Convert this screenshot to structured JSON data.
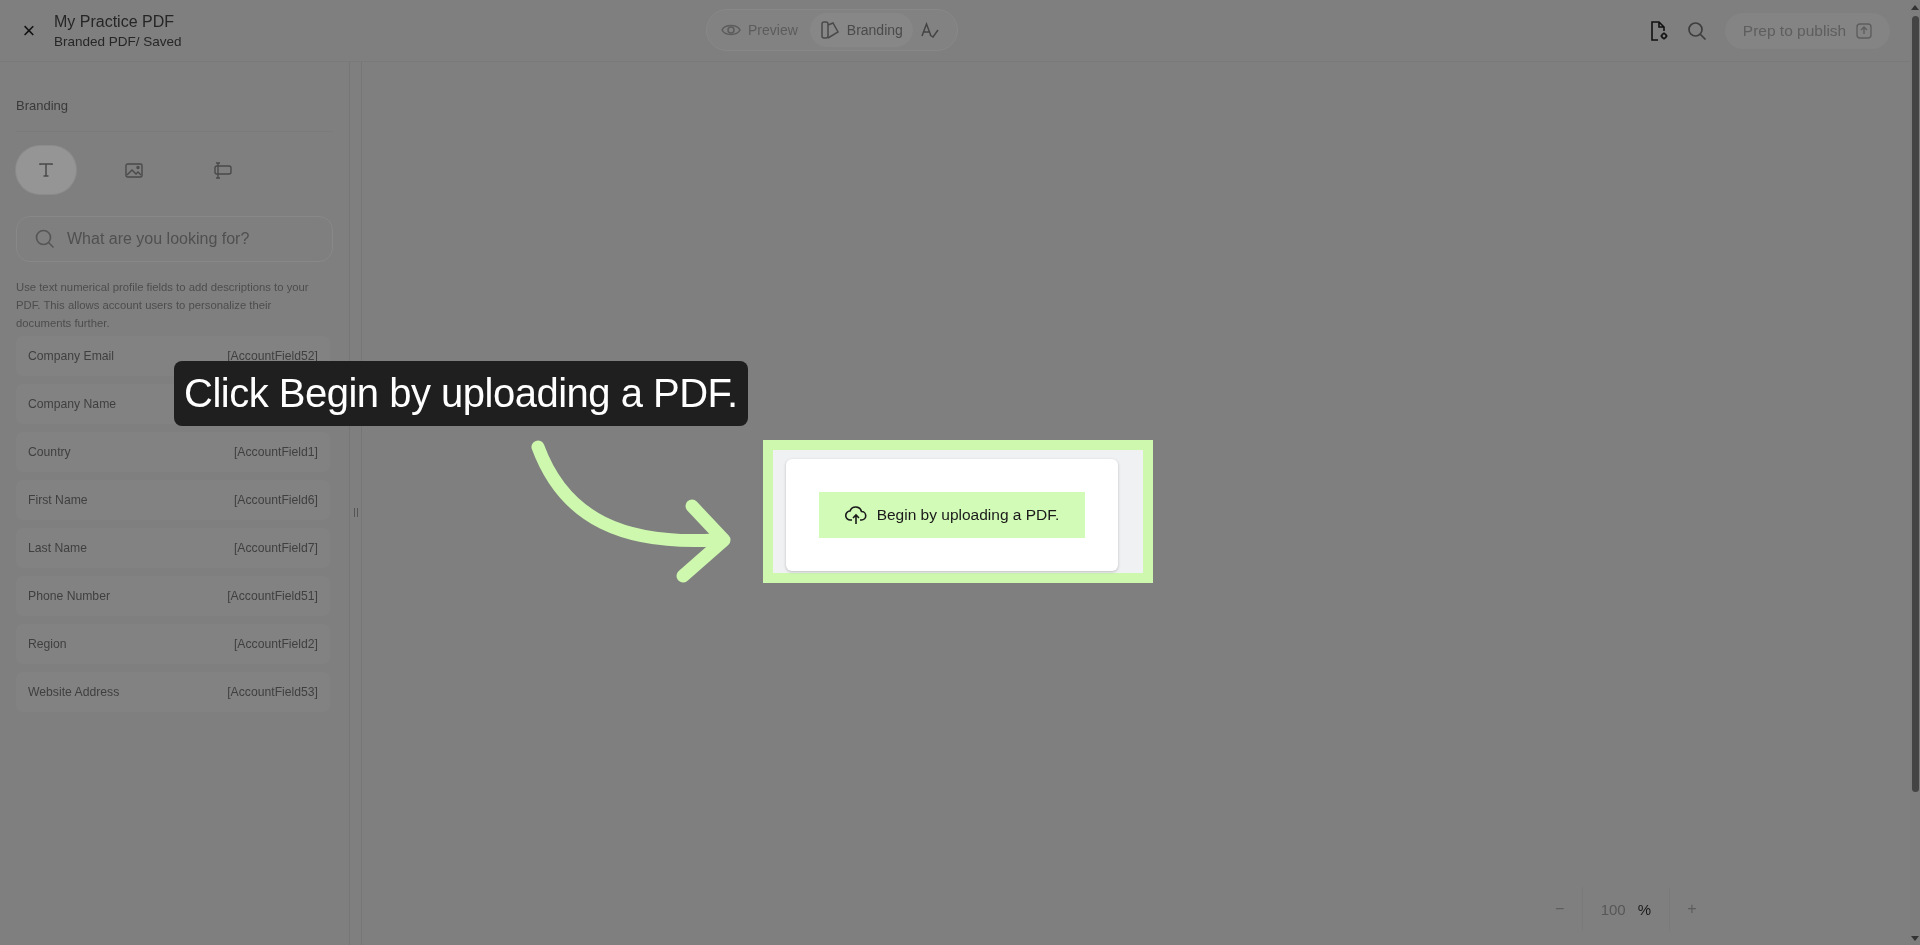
{
  "header": {
    "close": "×",
    "title": "My Practice PDF",
    "subtitle": "Branded PDF/ Saved"
  },
  "mode_tabs": [
    {
      "label": "Preview",
      "kind": "preview",
      "selected": false
    },
    {
      "label": "Branding",
      "kind": "branding",
      "selected": true
    }
  ],
  "actions": {
    "publish": "Prep to publish"
  },
  "sidebar": {
    "heading": "Branding",
    "tools": [
      {
        "kind": "text",
        "selected": true
      },
      {
        "kind": "image",
        "selected": false
      },
      {
        "kind": "field",
        "selected": false
      }
    ],
    "search": {
      "placeholder": "What are you looking for?"
    },
    "description": "Use text numerical profile fields to add descriptions to your PDF. This allows account users to personalize their documents further.",
    "fields": [
      {
        "label": "Company Email",
        "token": "[AccountField52]"
      },
      {
        "label": "Company Name"
      },
      {
        "label": "Country",
        "token": "[AccountField1]"
      },
      {
        "label": "First Name",
        "token": "[AccountField6]"
      },
      {
        "label": "Last Name",
        "token": "[AccountField7]"
      },
      {
        "label": "Phone Number",
        "token": "[AccountField51]"
      },
      {
        "label": "Region",
        "token": "[AccountField2]"
      },
      {
        "label": "Website Address",
        "token": "[AccountField53]"
      }
    ]
  },
  "canvas": {
    "upload_button": "Begin by uploading a PDF."
  },
  "zoom": {
    "minus": "−",
    "value": "100",
    "unit": "%",
    "plus": "+"
  },
  "guide": {
    "tooltip": "Click Begin by uploading a PDF."
  }
}
